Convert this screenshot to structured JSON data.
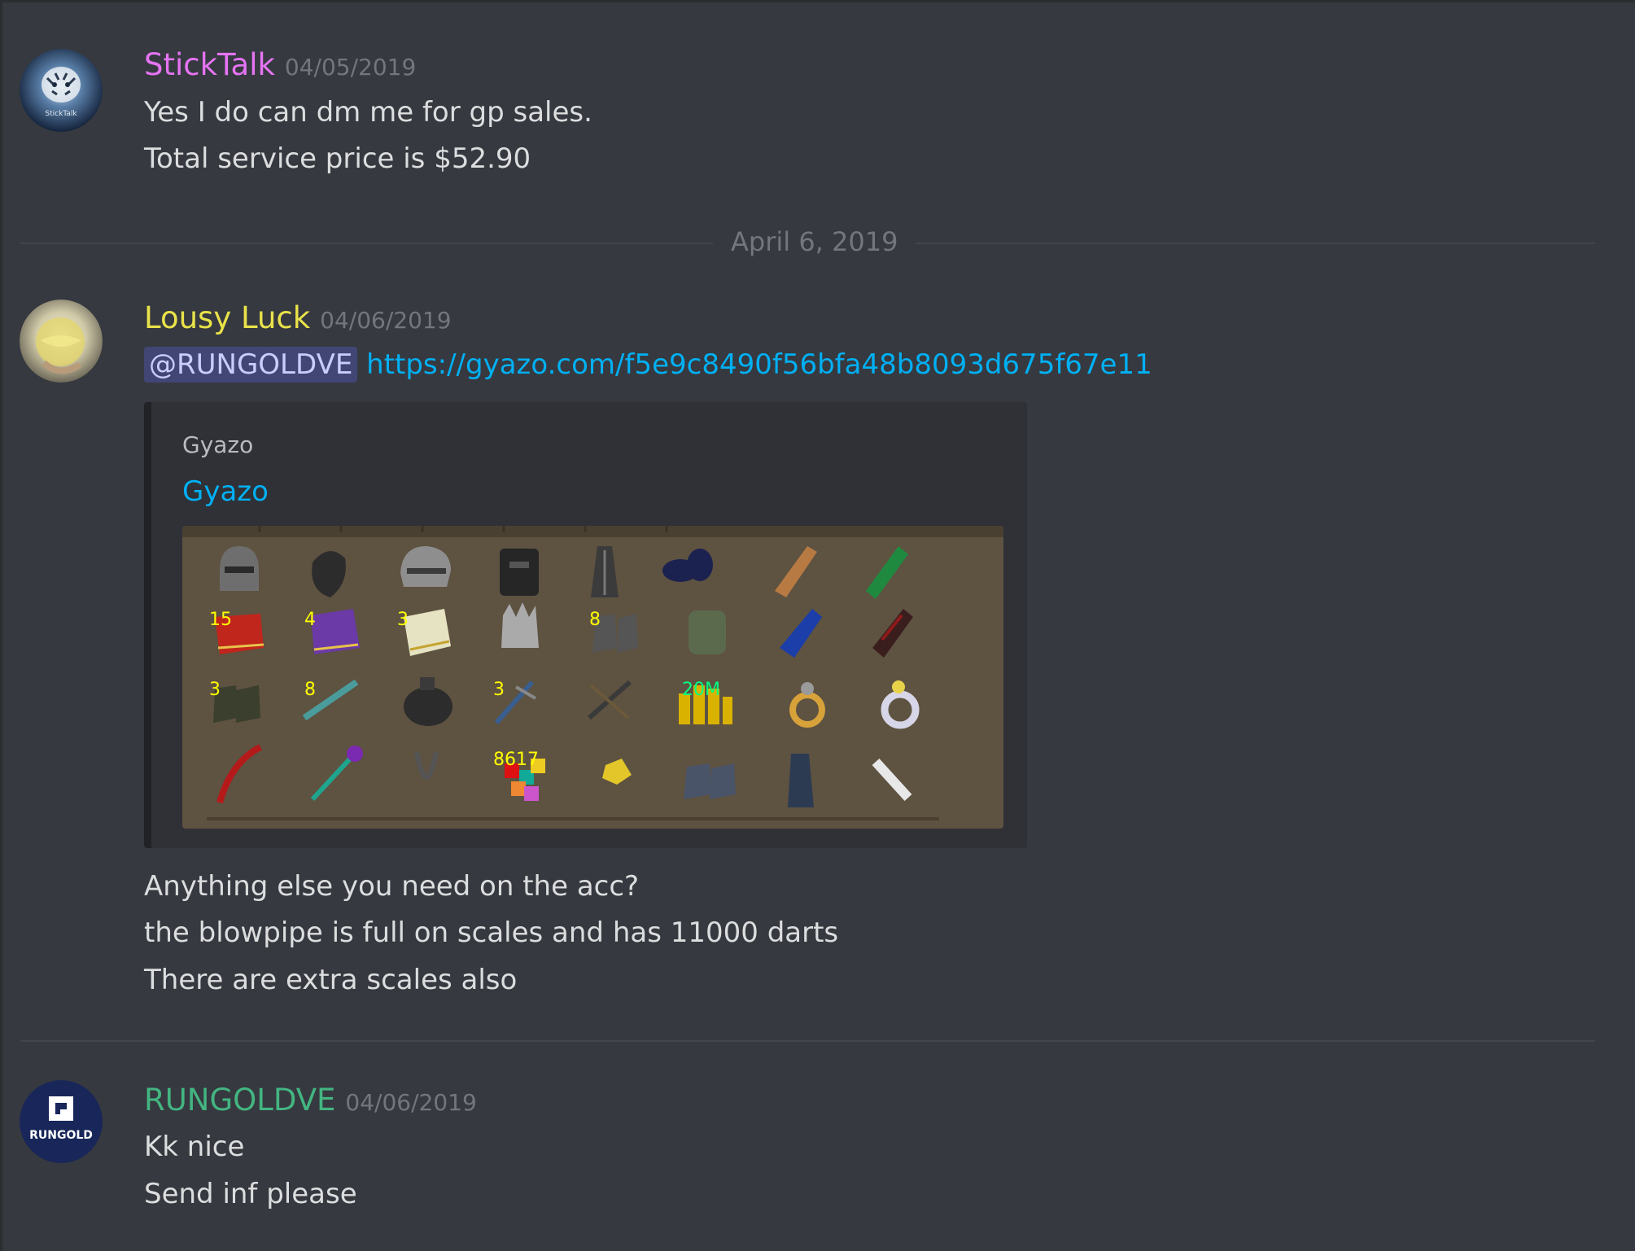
{
  "date_divider": "April 6, 2019",
  "messages": [
    {
      "username": "StickTalk",
      "username_color": "#e574f3",
      "timestamp": "04/05/2019",
      "avatar_label": "StickTalk",
      "lines": [
        "Yes I do can dm me for gp sales.",
        "Total service price is $52.90"
      ]
    },
    {
      "username": "Lousy Luck",
      "username_color": "#e9e34a",
      "timestamp": "04/06/2019",
      "mention": "@RUNGOLDVE",
      "link": "https://gyazo.com/f5e9c8490f56bfa48b8093d675f67e11",
      "embed": {
        "provider": "Gyazo",
        "title": "Gyazo",
        "image_icon": "runescape-inventory-screenshot",
        "stack_counts": [
          "15",
          "4",
          "3",
          "8",
          "3",
          "8",
          "3",
          "20M",
          "8617"
        ]
      },
      "lines": [
        "Anything else you need on the acc?",
        "the blowpipe is full on scales and has 11000 darts",
        "There are extra scales also"
      ]
    },
    {
      "username": "RUNGOLDVE",
      "username_color": "#43b581",
      "timestamp": "04/06/2019",
      "avatar_label": "RUNGOLD",
      "lines": [
        "Kk nice",
        "Send inf please"
      ]
    }
  ]
}
